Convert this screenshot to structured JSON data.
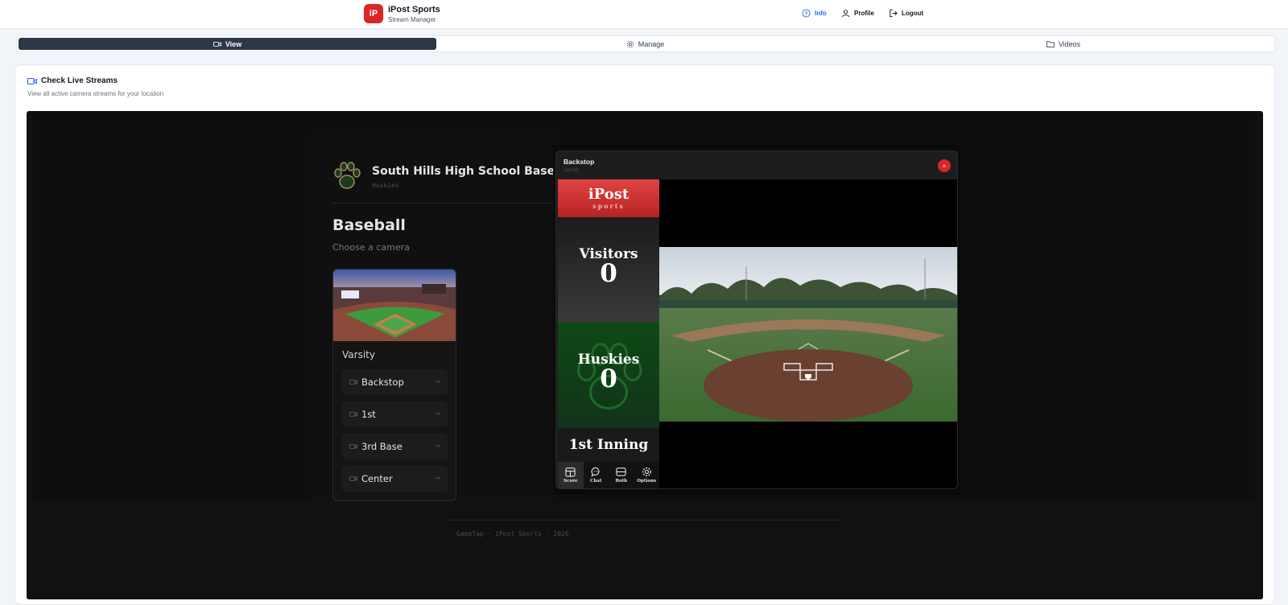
{
  "header": {
    "logo_text": "iP",
    "brand_title": "iPost Sports",
    "brand_subtitle": "Stream Manager",
    "nav": {
      "info": "Info",
      "profile": "Profile",
      "logout": "Logout"
    }
  },
  "tabs": {
    "view": "View",
    "manage": "Manage",
    "videos": "Videos"
  },
  "card": {
    "title": "Check Live Streams",
    "subtitle": "View all active camera streams for your location"
  },
  "stream_page": {
    "school_name": "South Hills High School Baseball",
    "team": "Huskies",
    "sport": "Baseball",
    "choose_prompt": "Choose a camera",
    "level": "Varsity",
    "cameras": [
      "Backstop",
      "1st",
      "3rd Base",
      "Center"
    ],
    "footer": "GameTap · iPost Sports · 2026"
  },
  "player": {
    "title": "Backstop",
    "subtitle": "Varsity",
    "close": "×",
    "scoreboard": {
      "logo_main": "iPost",
      "logo_sub": "sports",
      "visitors_label": "Visitors",
      "visitors_score": "0",
      "home_label": "Huskies",
      "home_score": "0",
      "inning": "1st Inning",
      "tabs": [
        "Score",
        "Chat",
        "Both",
        "Options"
      ]
    }
  },
  "colors": {
    "brand_red": "#dc2626",
    "active_tab": "#2d3748",
    "link_blue": "#2563eb",
    "home_green": "#0e4a14"
  }
}
